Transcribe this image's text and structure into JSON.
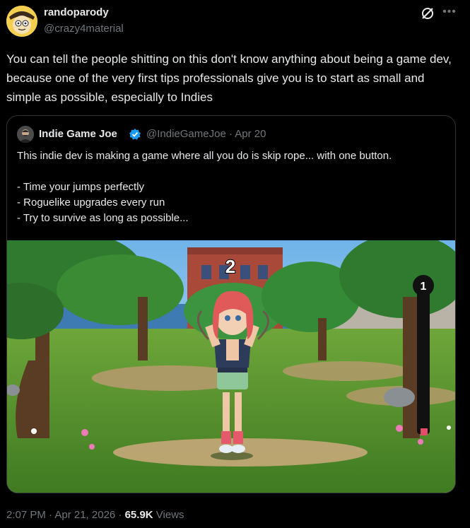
{
  "author": {
    "display_name": "randoparody",
    "handle": "@crazy4material",
    "avatar_icon": "avatar-cartoon-icon"
  },
  "tweet": {
    "text": "You can tell the people shitting on this don't know anything about being a game dev, because one of the very first tips professionals give you is to start as small and simple as possible, especially to Indies"
  },
  "quoted": {
    "display_name": "Indie Game Joe",
    "handle_date": "@IndieGameJoe · Apr 20",
    "lines": [
      "This indie dev is making a game where all you do is skip rope... with one button.",
      "",
      "- Time your jumps perfectly",
      "- Roguelike upgrades every run",
      "- Try to survive as long as possible..."
    ],
    "media": {
      "jump_count": "2",
      "meter_value": "1"
    }
  },
  "meta": {
    "time_date": "2:07 PM · Apr 21, 2026 · ",
    "views_count": "65.9K",
    "views_label": " Views"
  },
  "colors": {
    "background": "#000000",
    "text": "#e7e9ea",
    "muted": "#71767b",
    "verified": "#1d9bf0",
    "border": "#2f3336"
  }
}
